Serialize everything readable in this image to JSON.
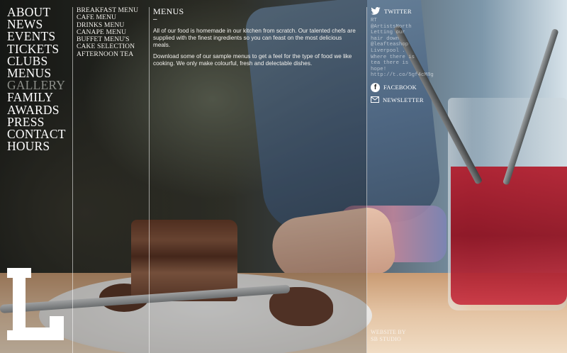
{
  "main_nav": [
    {
      "label": "ABOUT"
    },
    {
      "label": "NEWS"
    },
    {
      "label": "EVENTS"
    },
    {
      "label": "TICKETS"
    },
    {
      "label": "CLUBS"
    },
    {
      "label": "MENUS"
    },
    {
      "label": "GALLERY",
      "active": true
    },
    {
      "label": "FAMILY"
    },
    {
      "label": "AWARDS"
    },
    {
      "label": "PRESS"
    },
    {
      "label": "CONTACT"
    },
    {
      "label": "HOURS"
    }
  ],
  "sub_nav": [
    {
      "label": "BREAKFAST MENU"
    },
    {
      "label": "CAFE MENU"
    },
    {
      "label": "DRINKS MENU"
    },
    {
      "label": "CANAPE MENU"
    },
    {
      "label": "BUFFET MENU'S"
    },
    {
      "label": "CAKE SELECTION"
    },
    {
      "label": "AFTERNOON TEA"
    }
  ],
  "content": {
    "title": "MENUS",
    "dash": "–",
    "paragraphs": [
      "All of our food is homemade in our kitchen from scratch. Our talented chefs are supplied with the finest ingredients so you can feast on the most delicious meals.",
      "Download some of our sample menus to get a feel for the type of food we like cooking. We only make colourful, fresh and delectable dishes."
    ]
  },
  "social": {
    "twitter_label": "TWITTER",
    "tweet": "RT\n@ArtistsNorth\nLetting our\nhair down\n@leafteashop\nLiverpool .\nWhere there is\ntea there is\nhope!\nhttp://t.co/5gf4cM8g",
    "facebook_label": "FACEBOOK",
    "newsletter_label": "NEWSLETTER"
  },
  "credit": {
    "line1": "WEBSITE BY",
    "line2": "SB STUDIO"
  },
  "colors": {
    "text": "#ffffff",
    "active_nav": "#8d8f8a",
    "divider": "rgba(255,255,255,0.55)"
  }
}
